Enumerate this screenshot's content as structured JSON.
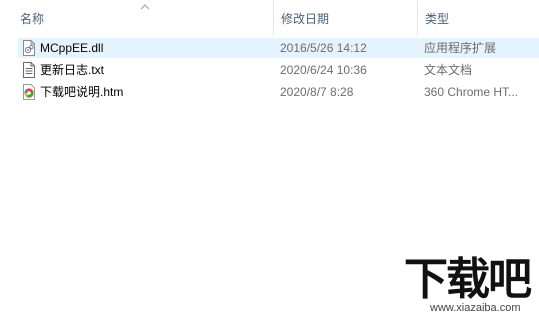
{
  "columns": {
    "name": "名称",
    "date": "修改日期",
    "type": "类型"
  },
  "files": [
    {
      "name": "MCppEE.dll",
      "date": "2016/5/26 14:12",
      "type": "应用程序扩展",
      "icon": "dll-file-icon",
      "selected": true
    },
    {
      "name": "更新日志.txt",
      "date": "2020/6/24 10:36",
      "type": "文本文档",
      "icon": "text-file-icon",
      "selected": false
    },
    {
      "name": "下载吧说明.htm",
      "date": "2020/8/7 8:28",
      "type": "360 Chrome HT...",
      "icon": "browser-html-file-icon",
      "selected": false
    }
  ],
  "watermark": {
    "logo_text": "下载吧",
    "url": "www.xiazaiba.com"
  },
  "colors": {
    "selection": "#e5f3ff",
    "header_text": "#4c607a",
    "meta_text": "#6d6d6d"
  }
}
